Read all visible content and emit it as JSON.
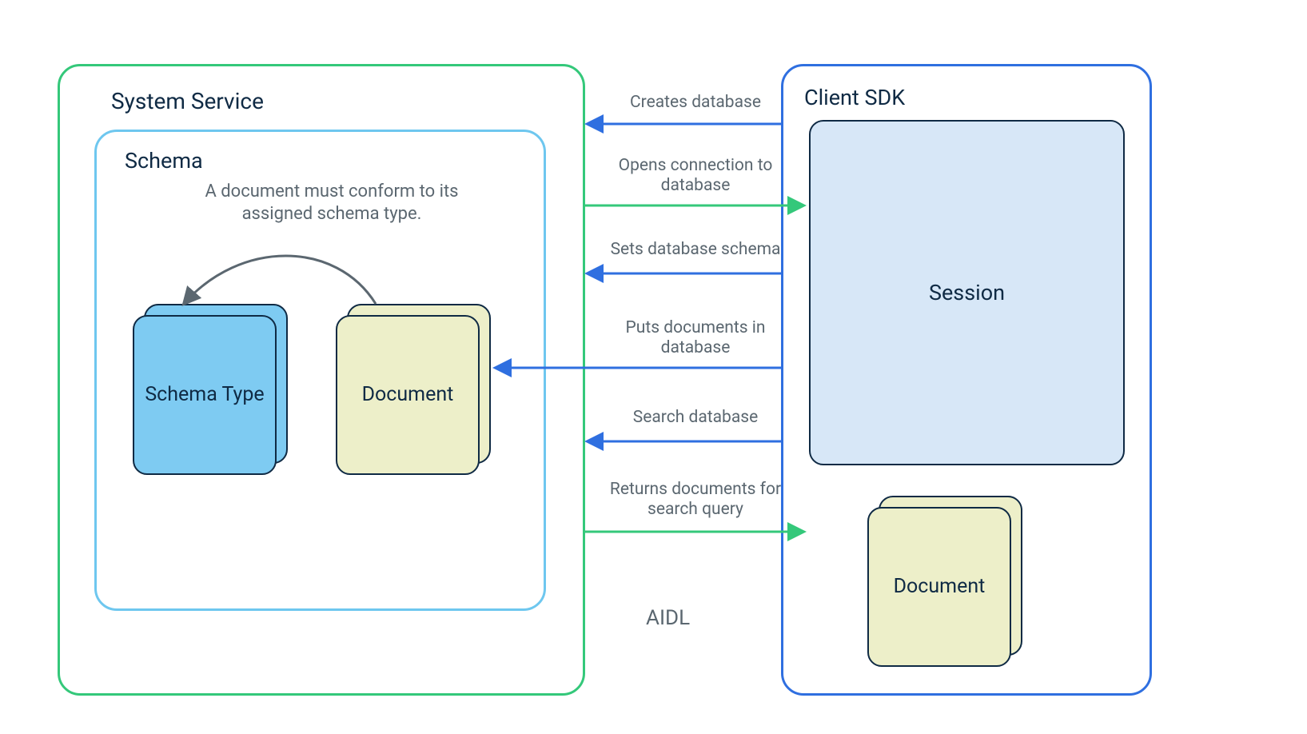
{
  "system_service": {
    "title": "System Service",
    "schema": {
      "title": "Schema",
      "note": "A document must conform to its assigned schema type.",
      "schema_type_card": "Schema\nType",
      "document_card": "Document"
    }
  },
  "client_sdk": {
    "title": "Client SDK",
    "session_card": "Session",
    "document_card": "Document"
  },
  "middle": {
    "aidl_label": "AIDL",
    "arrows": {
      "creates_db": "Creates database",
      "opens_connection": "Opens connection to\ndatabase",
      "sets_schema": "Sets database schema",
      "puts_documents": "Puts documents in\ndatabase",
      "search_db": "Search database",
      "returns_docs": "Returns documents for\nsearch query"
    }
  },
  "colors": {
    "green": "#34c87a",
    "blue": "#2f6fe0",
    "skyblue": "#6ec7ef",
    "navy": "#0f2a44",
    "session_fill": "#d7e7f7",
    "doc_fill": "#edefc9",
    "schema_type_fill": "#7ecbf2",
    "label_gray": "#5b6770"
  }
}
